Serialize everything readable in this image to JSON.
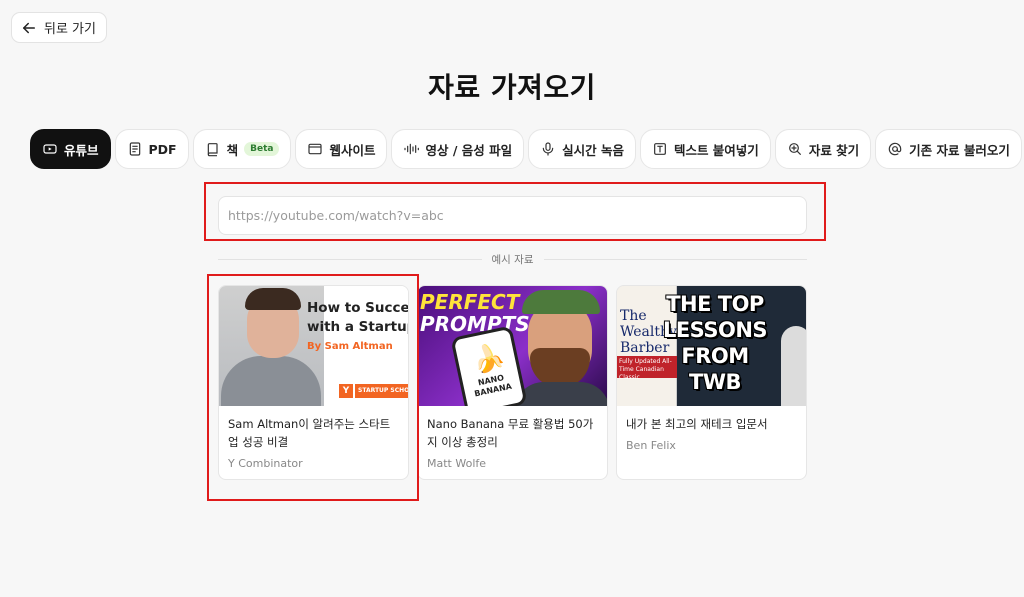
{
  "header": {
    "back_label": "뒤로 가기",
    "title": "자료 가져오기"
  },
  "tabs": [
    {
      "label": "유튜브",
      "icon": "youtube-icon",
      "active": true
    },
    {
      "label": "PDF",
      "icon": "document-icon",
      "active": false
    },
    {
      "label": "책",
      "icon": "book-icon",
      "badge": "Beta",
      "active": false
    },
    {
      "label": "웹사이트",
      "icon": "browser-window-icon",
      "active": false
    },
    {
      "label": "영상 / 음성 파일",
      "icon": "audio-wave-icon",
      "active": false
    },
    {
      "label": "실시간 녹음",
      "icon": "microphone-icon",
      "active": false
    },
    {
      "label": "텍스트 붙여넣기",
      "icon": "text-icon",
      "active": false
    },
    {
      "label": "자료 찾기",
      "icon": "search-plus-icon",
      "active": false
    },
    {
      "label": "기존 자료 불러오기",
      "icon": "at-sign-icon",
      "active": false
    }
  ],
  "url_input": {
    "placeholder": "https://youtube.com/watch?v=abc",
    "value": ""
  },
  "examples": {
    "divider_label": "예시 자료",
    "cards": [
      {
        "title": "Sam Altman이 알려주는 스타트업 성공 비결",
        "channel": "Y Combinator",
        "thumb_text": [
          "How to Succeed",
          "with a Startup",
          "By Sam Altman",
          "Y",
          "STARTUP SCHOOL"
        ]
      },
      {
        "title": "Nano Banana 무료 활용법 50가지 이상 총정리",
        "channel": "Matt Wolfe",
        "thumb_text": [
          "PERFECT",
          "PROMPTS",
          "NANO BANANA"
        ]
      },
      {
        "title": "내가 본 최고의 재테크 입문서",
        "channel": "Ben Felix",
        "thumb_text": [
          "The Wealthy Barber",
          "Fully Updated All-Time Canadian Classic",
          "THE TOP",
          "LESSONS",
          "FROM",
          "TWB"
        ]
      }
    ]
  },
  "colors": {
    "active_tab_bg": "#111111",
    "highlight": "#e01b1b",
    "beta_bg": "#e3f6d9",
    "beta_text": "#2e7d32"
  }
}
